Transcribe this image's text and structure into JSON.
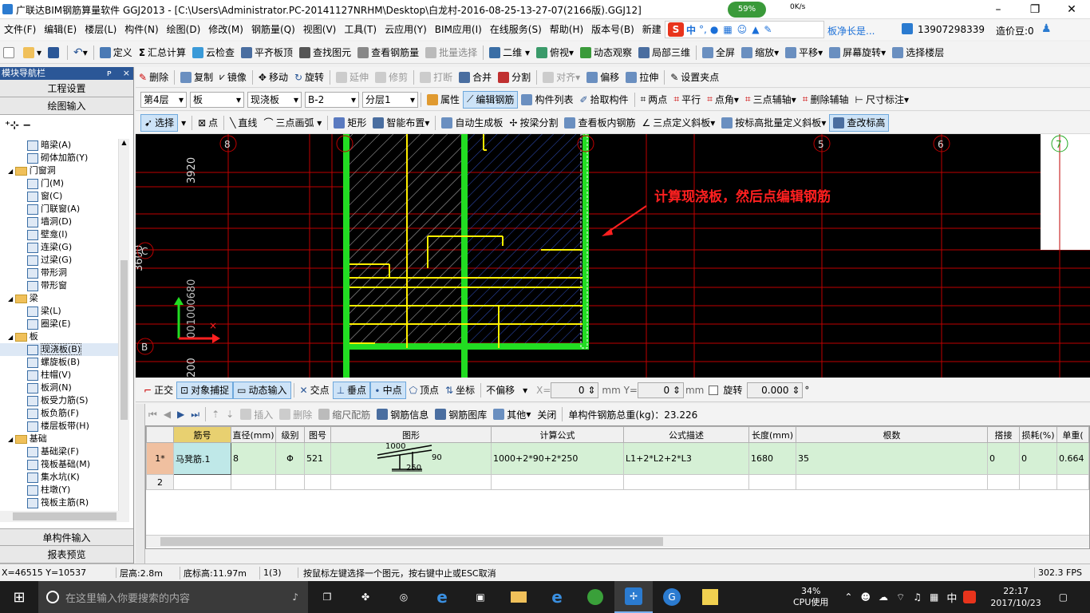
{
  "window": {
    "title": "广联达BIM钢筋算量软件 GGJ2013 - [C:\\Users\\Administrator.PC-20141127NRHM\\Desktop\\白龙村-2016-08-25-13-27-07(2166版).GGJ12]",
    "minimize": "–",
    "maximize": "❐",
    "close": "✕"
  },
  "overlay": {
    "net_percent": "59%",
    "net_speed": "0K/s",
    "hint": "板净长是..."
  },
  "menu": [
    "文件(F)",
    "编辑(E)",
    "楼层(L)",
    "构件(N)",
    "绘图(D)",
    "修改(M)",
    "钢筋量(Q)",
    "视图(V)",
    "工具(T)",
    "云应用(Y)",
    "BIM应用(I)",
    "在线服务(S)",
    "帮助(H)",
    "版本号(B)",
    "新建"
  ],
  "ime": {
    "lang": "中",
    "punct": "°,"
  },
  "account": {
    "phone": "13907298339",
    "price": "造价豆:0"
  },
  "toolbar1": {
    "define": "定义",
    "summary": "汇总计算",
    "cloud_check": "云检查",
    "flush_top": "平齐板顶",
    "find_element": "查找图元",
    "view_rebar": "查看钢筋量",
    "batch_select": "批量选择",
    "view_mode": "二维",
    "top_view": "俯视",
    "dynamic_view": "动态观察",
    "local_3d": "局部三维",
    "fullscreen": "全屏",
    "zoom": "缩放",
    "pan": "平移",
    "screen_rotate": "屏幕旋转",
    "select_floor": "选择楼层"
  },
  "toolbar2": {
    "delete": "删除",
    "copy": "复制",
    "mirror": "镜像",
    "move": "移动",
    "rotate": "旋转",
    "extend": "延伸",
    "trim": "修剪",
    "break": "打断",
    "merge": "合并",
    "split": "分割",
    "align": "对齐",
    "offset": "偏移",
    "stretch": "拉伸",
    "set_grip": "设置夹点"
  },
  "toolbar3": {
    "floor": "第4层",
    "category": "板",
    "type": "现浇板",
    "name": "B-2",
    "layer": "分层1",
    "properties": "属性",
    "edit_rebar": "编辑钢筋",
    "element_list": "构件列表",
    "pick_element": "拾取构件",
    "two_points": "两点",
    "parallel": "平行",
    "point_angle": "点角",
    "three_point_axis": "三点辅轴",
    "delete_axis": "删除辅轴",
    "dimension": "尺寸标注"
  },
  "toolbar4": {
    "select": "选择",
    "point": "点",
    "line": "直线",
    "arc": "三点画弧",
    "rect": "矩形",
    "smart_layout": "智能布置",
    "auto_slab": "自动生成板",
    "split_by_beam": "按梁分割",
    "view_slab_rebar": "查看板内钢筋",
    "three_point_slope": "三点定义斜板",
    "batch_slope": "按标高批量定义斜板",
    "check_elev": "查改标高"
  },
  "left_panel": {
    "header": "模块导航栏",
    "pin": "ᴘ",
    "close": "×",
    "project_settings": "工程设置",
    "drawing_input": "绘图输入",
    "tree": [
      {
        "label": "暗梁(A)",
        "level": 2
      },
      {
        "label": "砌体加筋(Y)",
        "level": 2
      },
      {
        "label": "门窗洞",
        "level": 1,
        "folder": true
      },
      {
        "label": "门(M)",
        "level": 2
      },
      {
        "label": "窗(C)",
        "level": 2
      },
      {
        "label": "门联窗(A)",
        "level": 2
      },
      {
        "label": "墙洞(D)",
        "level": 2
      },
      {
        "label": "壁龛(I)",
        "level": 2
      },
      {
        "label": "连梁(G)",
        "level": 2
      },
      {
        "label": "过梁(G)",
        "level": 2
      },
      {
        "label": "带形洞",
        "level": 2
      },
      {
        "label": "带形窗",
        "level": 2
      },
      {
        "label": "梁",
        "level": 1,
        "folder": true
      },
      {
        "label": "梁(L)",
        "level": 2
      },
      {
        "label": "圈梁(E)",
        "level": 2
      },
      {
        "label": "板",
        "level": 1,
        "folder": true
      },
      {
        "label": "现浇板(B)",
        "level": 2,
        "selected": true
      },
      {
        "label": "螺旋板(B)",
        "level": 2
      },
      {
        "label": "柱帽(V)",
        "level": 2
      },
      {
        "label": "板洞(N)",
        "level": 2
      },
      {
        "label": "板受力筋(S)",
        "level": 2
      },
      {
        "label": "板负筋(F)",
        "level": 2
      },
      {
        "label": "楼层板带(H)",
        "level": 2
      },
      {
        "label": "基础",
        "level": 1,
        "folder": true
      },
      {
        "label": "基础梁(F)",
        "level": 2
      },
      {
        "label": "筏板基础(M)",
        "level": 2
      },
      {
        "label": "集水坑(K)",
        "level": 2
      },
      {
        "label": "柱墩(Y)",
        "level": 2
      },
      {
        "label": "筏板主筋(R)",
        "level": 2
      }
    ],
    "single_input": "单构件输入",
    "report_preview": "报表预览"
  },
  "canvas": {
    "annotation": "计算现浇板，然后点编辑钢筋",
    "dim_3920": "3920",
    "dim_3600": "3600",
    "dim_200": "200",
    "dim_vert": "001000680",
    "axis_labels": [
      "8",
      "C",
      "B",
      "5",
      "6",
      "7",
      "8"
    ]
  },
  "snapbar": {
    "ortho": "正交",
    "obj_snap": "对象捕捉",
    "dyn_input": "动态输入",
    "intersection": "交点",
    "perpendicular": "垂点",
    "midpoint": "中点",
    "vertex": "顶点",
    "coord": "坐标",
    "offset_mode": "不偏移",
    "x_label": "X=",
    "x_value": "0",
    "y_label": "mm Y=",
    "y_value": "0",
    "mm": "mm",
    "rotate_label": "旋转",
    "rotate_value": "0.000",
    "deg": "°"
  },
  "grid_toolbar": {
    "insert": "插入",
    "delete": "删除",
    "scale_fit": "缩尺配筋",
    "rebar_info": "钢筋信息",
    "rebar_lib": "钢筋图库",
    "other": "其他",
    "close": "关闭",
    "total_weight": "单构件钢筋总重(kg)：23.226"
  },
  "grid": {
    "headers": [
      "",
      "筋号",
      "直径(mm)",
      "级别",
      "图号",
      "图形",
      "计算公式",
      "公式描述",
      "长度(mm)",
      "根数",
      "搭接",
      "损耗(%)",
      "单重("
    ],
    "rows": [
      {
        "idx": "1*",
        "name": "马凳筋.1",
        "diameter": "8",
        "grade": "Φ",
        "fig": "521",
        "shape_top": "1000",
        "shape_mid": "90",
        "shape_bot": "250",
        "formula": "1000+2*90+2*250",
        "desc": "L1+2*L2+2*L3",
        "length": "1680",
        "count": "35",
        "lap": "0",
        "loss": "0",
        "unit_weight": "0.664"
      },
      {
        "idx": "2",
        "name": "",
        "diameter": "",
        "grade": "",
        "fig": "",
        "shape_top": "",
        "shape_mid": "",
        "shape_bot": "",
        "formula": "",
        "desc": "",
        "length": "",
        "count": "",
        "lap": "",
        "loss": "",
        "unit_weight": ""
      }
    ]
  },
  "status": {
    "coords": "X=46515 Y=10537",
    "floor_height": "层高:2.8m",
    "base_elev": "底标高:11.97m",
    "selection": "1(3)",
    "hint": "按鼠标左键选择一个图元，按右键中止或ESC取消",
    "fps": "302.3 FPS"
  },
  "taskbar": {
    "search_placeholder": "在这里输入你要搜索的内容",
    "cpu_percent": "34%",
    "cpu_label": "CPU使用",
    "ime": "中",
    "time": "22:17",
    "date": "2017/10/23"
  },
  "colors": {
    "canvas_bg": "#000000",
    "grid_line": "#c00000",
    "slab_green": "#22dd22",
    "rebar_yellow": "#ffee00",
    "annotation_red": "#ff2020",
    "row_highlight": "#d5f0d5"
  }
}
